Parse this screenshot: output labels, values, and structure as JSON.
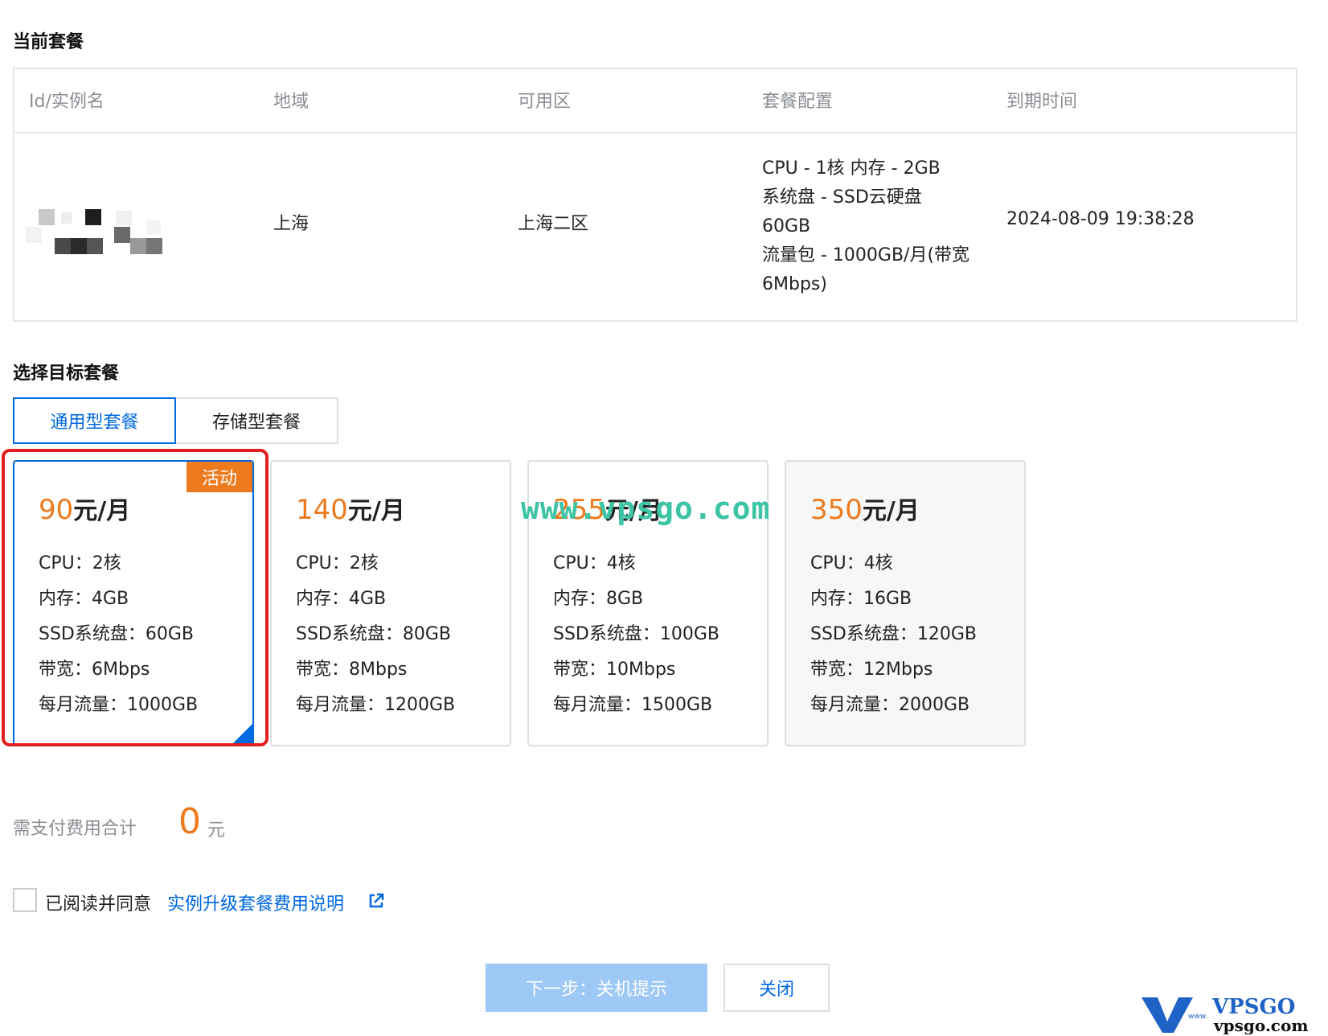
{
  "current_plan": {
    "title": "当前套餐",
    "columns": [
      "Id/实例名",
      "地域",
      "可用区",
      "套餐配置",
      "到期时间"
    ],
    "row": {
      "region": "上海",
      "zone": "上海二区",
      "config_lines": [
        "CPU - 1核 内存 - 2GB",
        "系统盘 - SSD云硬盘",
        "60GB",
        "流量包 - 1000GB/月(带宽",
        "6Mbps)"
      ],
      "expire": "2024-08-09 19:38:28"
    }
  },
  "target": {
    "title": "选择目标套餐",
    "tabs": [
      {
        "label": "通用型套餐",
        "active": true
      },
      {
        "label": "存储型套餐",
        "active": false
      }
    ]
  },
  "plans": [
    {
      "price": "90",
      "unit": "元/月",
      "badge": "活动",
      "selected": true,
      "specs": [
        "CPU：2核",
        "内存：4GB",
        "SSD系统盘：60GB",
        "带宽：6Mbps",
        "每月流量：1000GB"
      ]
    },
    {
      "price": "140",
      "unit": "元/月",
      "specs": [
        "CPU：2核",
        "内存：4GB",
        "SSD系统盘：80GB",
        "带宽：8Mbps",
        "每月流量：1200GB"
      ]
    },
    {
      "price": "255",
      "unit": "元/月",
      "specs": [
        "CPU：4核",
        "内存：8GB",
        "SSD系统盘：100GB",
        "带宽：10Mbps",
        "每月流量：1500GB"
      ]
    },
    {
      "price": "350",
      "unit": "元/月",
      "specs": [
        "CPU：4核",
        "内存：16GB",
        "SSD系统盘：120GB",
        "带宽：12Mbps",
        "每月流量：2000GB"
      ]
    }
  ],
  "watermark": "www.vpsgo.com",
  "total": {
    "label": "需支付费用合计",
    "amount": "0",
    "unit": "元"
  },
  "agreement": {
    "prefix": "已阅读并同意",
    "link": "实例升级套餐费用说明"
  },
  "buttons": {
    "next": "下一步：关机提示",
    "close": "关闭"
  },
  "logo": {
    "line1": "VPSGO",
    "line2": "vpsgo.com",
    "small": "www."
  },
  "colors": {
    "accent": "#0069e0",
    "price": "#ed7a1c",
    "highlight": "#e02020",
    "watermark": "#3cc4a4"
  }
}
